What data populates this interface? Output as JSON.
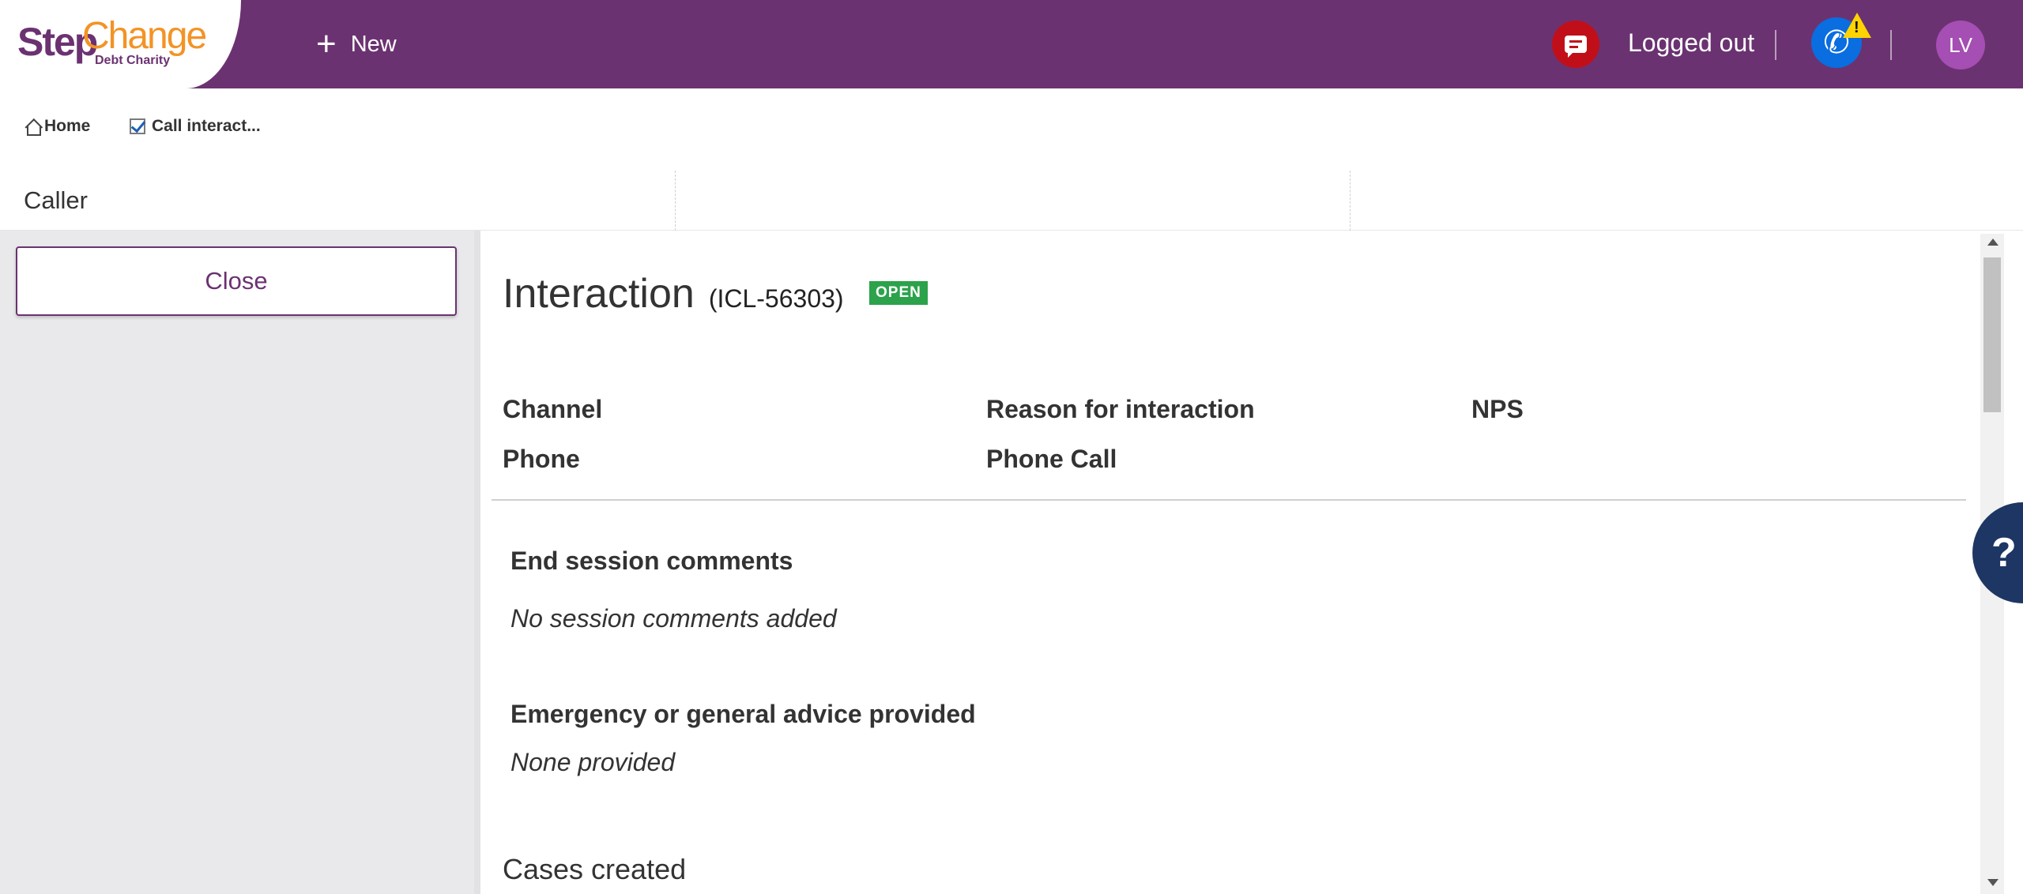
{
  "header": {
    "logo": {
      "step": "Step",
      "change": "Change",
      "sub": "Debt Charity"
    },
    "new_label": "New",
    "status_label": "Logged out",
    "avatar_initials": "LV",
    "colors": {
      "brand_purple": "#6b3271",
      "brand_orange": "#f39325",
      "chat_red": "#c10f1a",
      "phone_blue": "#0a6de0",
      "warning_yellow": "#ffd400"
    }
  },
  "tabs": [
    {
      "label": "Home",
      "icon": "home-icon"
    },
    {
      "label": "Call interact...",
      "icon": "checkbox-icon"
    }
  ],
  "caller": {
    "label": "Caller"
  },
  "left_pane": {
    "close_label": "Close"
  },
  "interaction": {
    "title": "Interaction",
    "id": "(ICL-56303)",
    "status_badge": "OPEN",
    "status_color": "#2ca24b",
    "fields": [
      {
        "label": "Channel",
        "value": "Phone"
      },
      {
        "label": "Reason for interaction",
        "value": "Phone Call"
      },
      {
        "label": "NPS",
        "value": ""
      }
    ],
    "end_session": {
      "heading": "End session comments",
      "text": "No session comments added"
    },
    "advice": {
      "heading": "Emergency or general advice provided",
      "text": "None provided"
    },
    "cases_heading": "Cases created"
  },
  "help": {
    "label": "?"
  }
}
